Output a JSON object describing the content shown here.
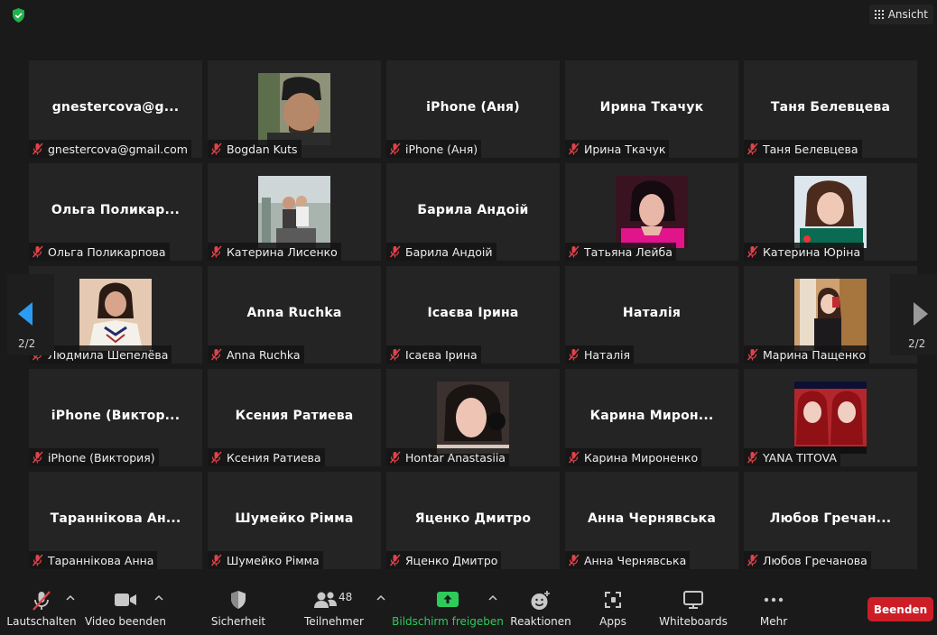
{
  "topbar": {
    "view_label": "Ansicht"
  },
  "nav": {
    "page_left": "2/2",
    "page_right": "2/2"
  },
  "participants": [
    {
      "big": "gnestercova@g...",
      "label": "gnestercova@gmail.com",
      "photo": null
    },
    {
      "big": "",
      "label": "Bogdan Kuts",
      "photo": "man-beanie"
    },
    {
      "big": "iPhone (Аня)",
      "label": "iPhone (Аня)",
      "photo": null
    },
    {
      "big": "Ирина Ткачук",
      "label": "Ирина Ткачук",
      "photo": null
    },
    {
      "big": "Таня Белевцева",
      "label": "Таня Белевцева",
      "photo": null
    },
    {
      "big": "Ольга  Поликар...",
      "label": "Ольга Поликарпова",
      "photo": null
    },
    {
      "big": "",
      "label": "Катерина Лисенко",
      "photo": "group-outdoor"
    },
    {
      "big": "Барила Андоій",
      "label": "Барила Андоій",
      "photo": null
    },
    {
      "big": "",
      "label": "Татьяна Лейба",
      "photo": "woman-pink"
    },
    {
      "big": "",
      "label": "Катерина Юріна",
      "photo": "woman-green"
    },
    {
      "big": "",
      "label": "Людмила Шепелёва",
      "photo": "woman-embroidered"
    },
    {
      "big": "Anna Ruchka",
      "label": "Anna Ruchka",
      "photo": null
    },
    {
      "big": "Ісаєва Ірина",
      "label": "Ісаєва Ірина",
      "photo": null
    },
    {
      "big": "Наталія",
      "label": "Наталія",
      "photo": null
    },
    {
      "big": "",
      "label": "Марина Пащенко",
      "photo": "woman-mirror"
    },
    {
      "big": "iPhone  (Виктор...",
      "label": "iPhone (Виктория)",
      "photo": null
    },
    {
      "big": "Ксения Ратиева",
      "label": "Ксения Ратиева",
      "photo": null
    },
    {
      "big": "",
      "label": "Hontar Anastasiia",
      "photo": "woman-dark-hair"
    },
    {
      "big": "Карина  Мирон...",
      "label": "Карина Мироненко",
      "photo": null
    },
    {
      "big": "",
      "label": "YANA TITOVA",
      "photo": "two-girls-red"
    },
    {
      "big": "Тараннікова  Ан...",
      "label": "Тараннікова Анна",
      "photo": null
    },
    {
      "big": "Шумейко Рімма",
      "label": "Шумейко Рімма",
      "photo": null
    },
    {
      "big": "Яценко Дмитро",
      "label": "Яценко Дмитро",
      "photo": null
    },
    {
      "big": "Анна Чернявська",
      "label": "Анна Чернявська",
      "photo": null
    },
    {
      "big": "Любов  Гречан...",
      "label": "Любов Гречанова",
      "photo": null
    }
  ],
  "toolbar": {
    "mute_label": "Lautschalten",
    "video_label": "Video beenden",
    "security_label": "Sicherheit",
    "participants_label": "Teilnehmer",
    "participants_count": "48",
    "share_label": "Bildschirm freigeben",
    "reactions_label": "Reaktionen",
    "apps_label": "Apps",
    "whiteboards_label": "Whiteboards",
    "more_label": "Mehr",
    "end_label": "Beenden"
  },
  "colors": {
    "accent_green": "#2dcc5a",
    "end_red": "#cd1e27",
    "muted_red": "#e0434b",
    "nav_blue": "#2b9cf2"
  }
}
